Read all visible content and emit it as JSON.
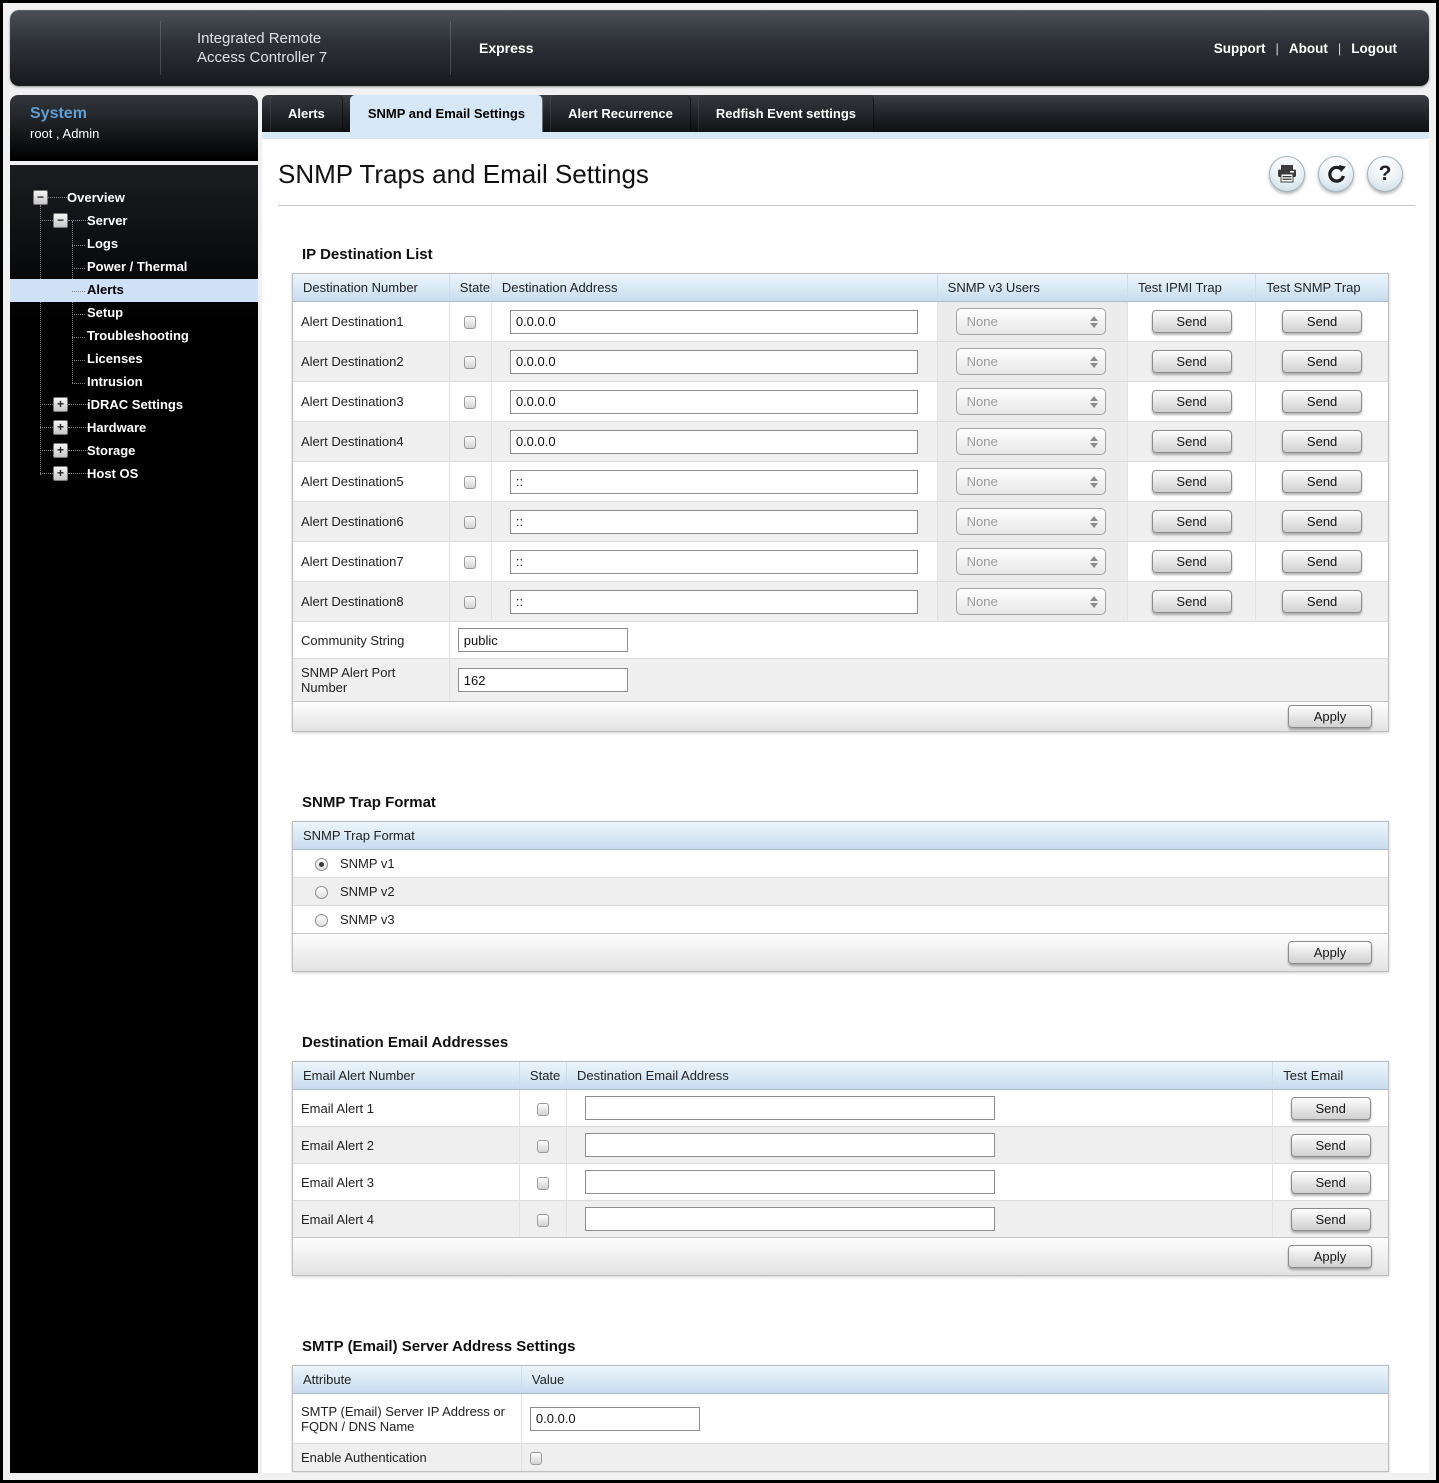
{
  "header": {
    "product_line1": "Integrated Remote",
    "product_line2": "Access Controller 7",
    "edition": "Express",
    "links": [
      "Support",
      "About",
      "Logout"
    ],
    "link_separator": "|"
  },
  "sidebar": {
    "system_label": "System",
    "user_info": "root , Admin",
    "tree": [
      {
        "label": "Overview",
        "level": 1,
        "expander": "minus"
      },
      {
        "label": "Server",
        "level": 2,
        "expander": "minus"
      },
      {
        "label": "Logs",
        "level": 3
      },
      {
        "label": "Power / Thermal",
        "level": 3
      },
      {
        "label": "Alerts",
        "level": 3,
        "selected": true
      },
      {
        "label": "Setup",
        "level": 3
      },
      {
        "label": "Troubleshooting",
        "level": 3
      },
      {
        "label": "Licenses",
        "level": 3
      },
      {
        "label": "Intrusion",
        "level": 3
      },
      {
        "label": "iDRAC Settings",
        "level": 2,
        "expander": "plus"
      },
      {
        "label": "Hardware",
        "level": 2,
        "expander": "plus"
      },
      {
        "label": "Storage",
        "level": 2,
        "expander": "plus"
      },
      {
        "label": "Host OS",
        "level": 2,
        "expander": "plus"
      }
    ]
  },
  "tabs": [
    {
      "label": "Alerts",
      "active": false
    },
    {
      "label": "SNMP and Email Settings",
      "active": true
    },
    {
      "label": "Alert Recurrence",
      "active": false
    },
    {
      "label": "Redfish Event settings",
      "active": false
    }
  ],
  "page": {
    "title": "SNMP Traps and Email Settings",
    "toolbar_icons": [
      "print-icon",
      "refresh-icon",
      "help-icon"
    ]
  },
  "buttons": {
    "send": "Send",
    "apply": "Apply"
  },
  "ip_destination_list": {
    "heading": "IP Destination List",
    "columns": [
      "Destination Number",
      "State",
      "Destination Address",
      "SNMP v3 Users",
      "Test IPMI Trap",
      "Test SNMP Trap"
    ],
    "rows": [
      {
        "name": "Alert Destination1",
        "state": false,
        "address": "0.0.0.0",
        "snmp_v3_user": "None"
      },
      {
        "name": "Alert Destination2",
        "state": false,
        "address": "0.0.0.0",
        "snmp_v3_user": "None"
      },
      {
        "name": "Alert Destination3",
        "state": false,
        "address": "0.0.0.0",
        "snmp_v3_user": "None"
      },
      {
        "name": "Alert Destination4",
        "state": false,
        "address": "0.0.0.0",
        "snmp_v3_user": "None"
      },
      {
        "name": "Alert Destination5",
        "state": false,
        "address": "::",
        "snmp_v3_user": "None"
      },
      {
        "name": "Alert Destination6",
        "state": false,
        "address": "::",
        "snmp_v3_user": "None"
      },
      {
        "name": "Alert Destination7",
        "state": false,
        "address": "::",
        "snmp_v3_user": "None"
      },
      {
        "name": "Alert Destination8",
        "state": false,
        "address": "::",
        "snmp_v3_user": "None"
      }
    ],
    "community_string": {
      "label": "Community String",
      "value": "public"
    },
    "alert_port": {
      "label": "SNMP Alert Port Number",
      "value": "162"
    }
  },
  "snmp_trap_format": {
    "heading": "SNMP Trap Format",
    "table_header": "SNMP Trap Format",
    "options": [
      {
        "label": "SNMP v1",
        "selected": true
      },
      {
        "label": "SNMP v2",
        "selected": false
      },
      {
        "label": "SNMP v3",
        "selected": false
      }
    ]
  },
  "destination_emails": {
    "heading": "Destination Email Addresses",
    "columns": [
      "Email Alert Number",
      "State",
      "Destination Email Address",
      "Test Email"
    ],
    "rows": [
      {
        "name": "Email Alert 1",
        "state": false,
        "address": ""
      },
      {
        "name": "Email Alert 2",
        "state": false,
        "address": ""
      },
      {
        "name": "Email Alert 3",
        "state": false,
        "address": ""
      },
      {
        "name": "Email Alert 4",
        "state": false,
        "address": ""
      }
    ]
  },
  "smtp_settings": {
    "heading": "SMTP (Email) Server Address Settings",
    "columns": [
      "Attribute",
      "Value"
    ],
    "rows": [
      {
        "attribute": "SMTP (Email) Server IP Address or FQDN / DNS Name",
        "type": "text",
        "value": "0.0.0.0"
      },
      {
        "attribute": "Enable Authentication",
        "type": "checkbox",
        "checked": false
      }
    ]
  },
  "colors": {
    "active_tab": "#d6e7f6",
    "selected_nav": "#cfe1f7",
    "table_header_top": "#ecf4fb",
    "table_header_bottom": "#c8dcee"
  }
}
